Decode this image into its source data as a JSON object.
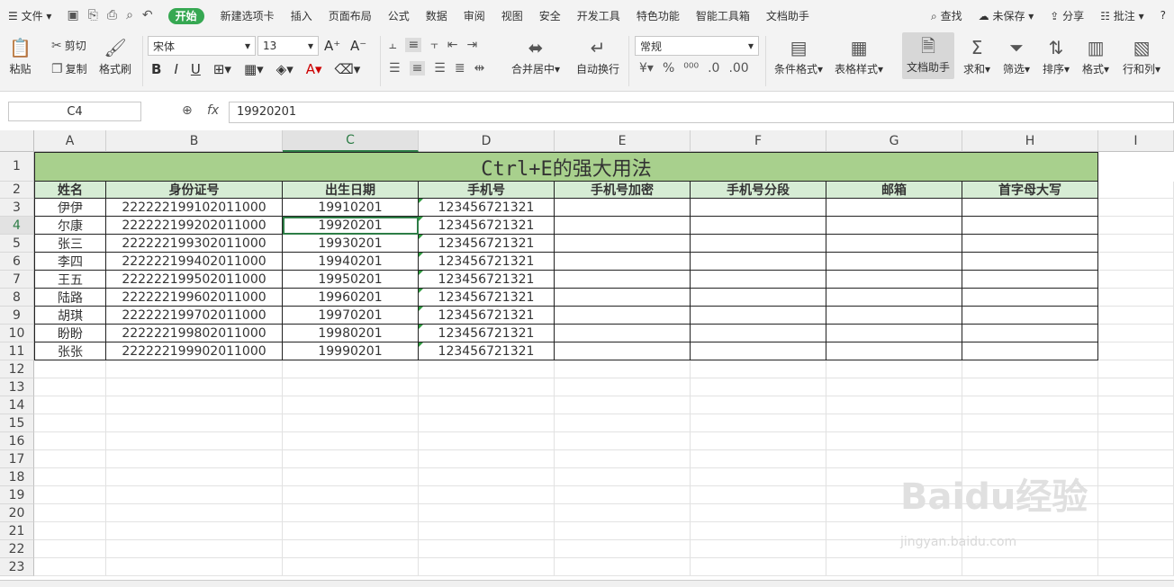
{
  "menubar": {
    "file": "文件",
    "tabs": [
      "开始",
      "新建选项卡",
      "插入",
      "页面布局",
      "公式",
      "数据",
      "审阅",
      "视图",
      "安全",
      "开发工具",
      "特色功能",
      "智能工具箱",
      "文档助手"
    ],
    "search": "查找",
    "unsaved": "未保存",
    "share": "分享",
    "comment": "批注",
    "help": "?"
  },
  "ribbon": {
    "paste": "粘贴",
    "cut": "剪切",
    "copy": "复制",
    "format_painter": "格式刷",
    "font_name": "宋体",
    "font_size": "13",
    "merge_center": "合并居中",
    "wrap_text": "自动换行",
    "number_format": "常规",
    "conditional_format": "条件格式",
    "table_style": "表格样式",
    "doc_assistant": "文档助手",
    "sum": "求和",
    "filter": "筛选",
    "sort": "排序",
    "format": "格式",
    "row_col": "行和列"
  },
  "formula": {
    "name_box": "C4",
    "fx": "fx",
    "content": "19920201"
  },
  "sheet": {
    "columns": [
      "A",
      "B",
      "C",
      "D",
      "E",
      "F",
      "G",
      "H",
      "I"
    ],
    "rows": [
      "1",
      "2",
      "3",
      "4",
      "5",
      "6",
      "7",
      "8",
      "9",
      "10",
      "11",
      "12",
      "13",
      "14",
      "15",
      "16",
      "17",
      "18",
      "19",
      "20",
      "21",
      "22",
      "23"
    ],
    "title": "Ctrl+E的强大用法",
    "headers": [
      "姓名",
      "身份证号",
      "出生日期",
      "手机号",
      "手机号加密",
      "手机号分段",
      "邮箱",
      "首字母大写"
    ],
    "data": [
      [
        "伊伊",
        "222222199102011000",
        "19910201",
        "123456721321"
      ],
      [
        "尔康",
        "222222199202011000",
        "19920201",
        "123456721321"
      ],
      [
        "张三",
        "222222199302011000",
        "19930201",
        "123456721321"
      ],
      [
        "李四",
        "222222199402011000",
        "19940201",
        "123456721321"
      ],
      [
        "王五",
        "222222199502011000",
        "19950201",
        "123456721321"
      ],
      [
        "陆路",
        "222222199602011000",
        "19960201",
        "123456721321"
      ],
      [
        "胡琪",
        "222222199702011000",
        "19970201",
        "123456721321"
      ],
      [
        "盼盼",
        "222222199802011000",
        "19980201",
        "123456721321"
      ],
      [
        "张张",
        "222222199902011000",
        "19990201",
        "123456721321"
      ]
    ]
  },
  "watermark": {
    "brand": "Baidu经验",
    "url": "jingyan.baidu.com"
  },
  "colors": {
    "title_bg": "#a8d08d",
    "header_bg": "#d6ecd4",
    "active_tab": "#36a852"
  }
}
